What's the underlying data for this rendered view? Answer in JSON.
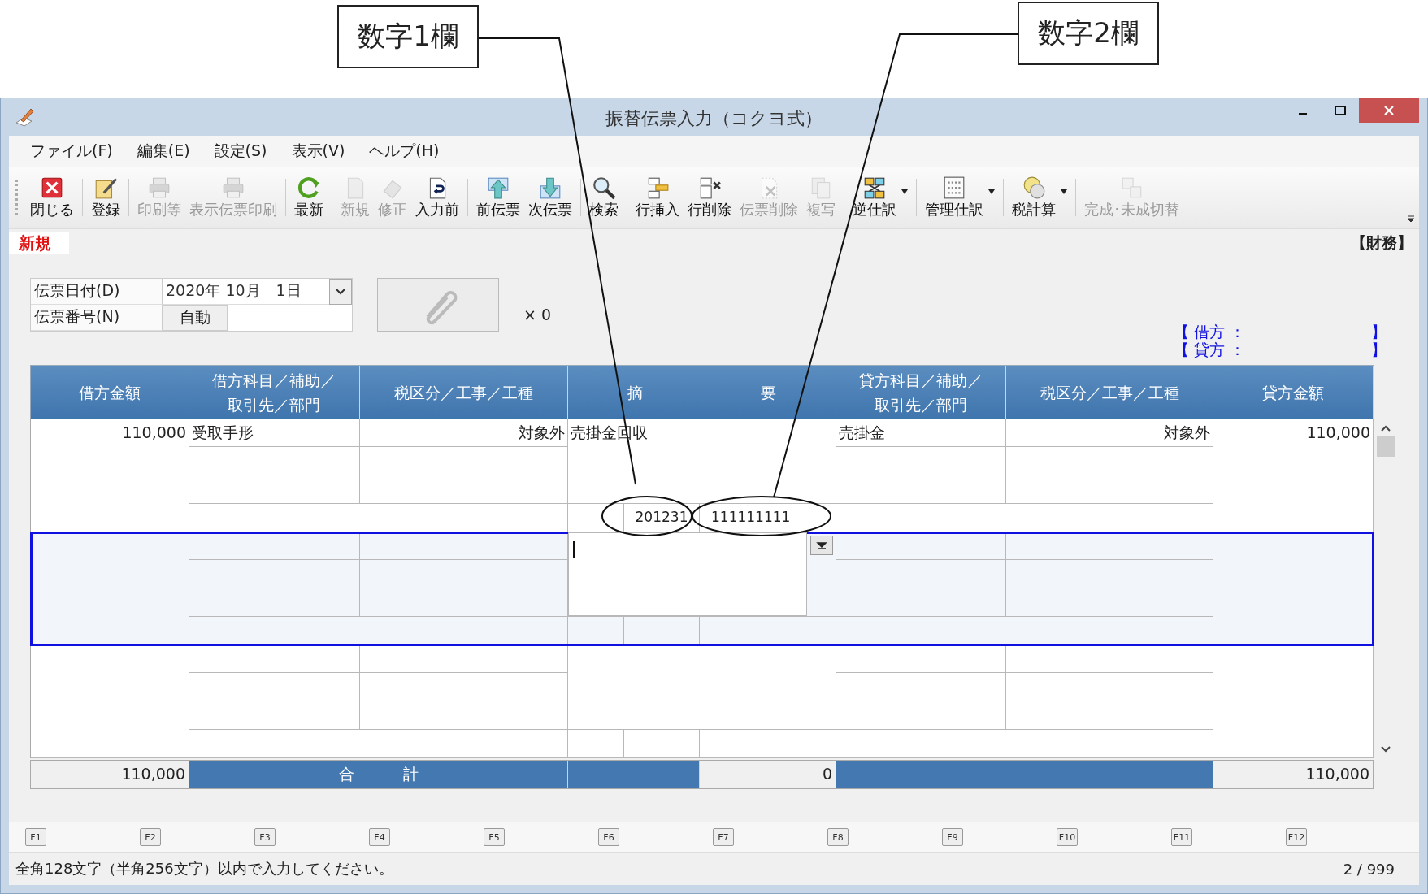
{
  "callouts": [
    {
      "label": "数字1欄"
    },
    {
      "label": "数字2欄"
    }
  ],
  "window": {
    "title": "振替伝票入力（コクヨ式）"
  },
  "menu": [
    {
      "label": "ファイル(F)"
    },
    {
      "label": "編集(E)"
    },
    {
      "label": "設定(S)"
    },
    {
      "label": "表示(V)"
    },
    {
      "label": "ヘルプ(H)"
    }
  ],
  "toolbar": [
    {
      "label": "閉じる",
      "disabled": false,
      "dropdown": false
    },
    {
      "label": "登録",
      "disabled": false,
      "dropdown": false
    },
    {
      "label": "印刷等",
      "disabled": true,
      "dropdown": false
    },
    {
      "label": "表示伝票印刷",
      "disabled": true,
      "dropdown": false
    },
    {
      "label": "最新",
      "disabled": false,
      "dropdown": false
    },
    {
      "label": "新規",
      "disabled": true,
      "dropdown": false
    },
    {
      "label": "修正",
      "disabled": true,
      "dropdown": false
    },
    {
      "label": "入力前",
      "disabled": false,
      "dropdown": false
    },
    {
      "label": "前伝票",
      "disabled": false,
      "dropdown": false
    },
    {
      "label": "次伝票",
      "disabled": false,
      "dropdown": false
    },
    {
      "label": "検索",
      "disabled": false,
      "dropdown": false
    },
    {
      "label": "行挿入",
      "disabled": false,
      "dropdown": false
    },
    {
      "label": "行削除",
      "disabled": false,
      "dropdown": false
    },
    {
      "label": "伝票削除",
      "disabled": true,
      "dropdown": false
    },
    {
      "label": "複写",
      "disabled": true,
      "dropdown": false
    },
    {
      "label": "逆仕訳",
      "disabled": false,
      "dropdown": true
    },
    {
      "label": "管理仕訳",
      "disabled": false,
      "dropdown": true
    },
    {
      "label": "税計算",
      "disabled": false,
      "dropdown": true
    },
    {
      "label": "完成･未成切替",
      "disabled": true,
      "dropdown": false
    }
  ],
  "mode": "新規",
  "division": "【財務】",
  "form": {
    "date_label": "伝票日付(D)",
    "date_value": "2020年 10月　1日",
    "number_label": "伝票番号(N)",
    "number_value": "自動",
    "attachment_count": "× 0"
  },
  "balance": [
    {
      "open": "【",
      "label": "借方 ：",
      "close": "】"
    },
    {
      "open": "【",
      "label": "貸方 ：",
      "close": "】"
    }
  ],
  "columns": [
    {
      "label": "借方金額"
    },
    {
      "label": "借方科目／補助／取引先／部門"
    },
    {
      "label": "税区分／工事／工種"
    },
    {
      "label": "摘",
      "label_2": "要"
    },
    {
      "label": "貸方科目／補助／取引先／部門"
    },
    {
      "label": "税区分／工事／工種"
    },
    {
      "label": "貸方金額"
    }
  ],
  "entries": [
    {
      "selected": false,
      "debit_amount": "110,000",
      "debit_account": "受取手形",
      "debit_tax": "対象外",
      "summary": "売掛金回収",
      "number_1": "201231",
      "number_2": "111111111",
      "credit_account": "売掛金",
      "credit_tax": "対象外",
      "credit_amount": "110,000"
    },
    {
      "selected": true
    },
    {
      "selected": false
    }
  ],
  "totals": {
    "debit": "110,000",
    "label": "合",
    "label_2": "計",
    "summary": "0",
    "credit": "110,000"
  },
  "function_keys": [
    "F1",
    "F2",
    "F3",
    "F4",
    "F5",
    "F6",
    "F7",
    "F8",
    "F9",
    "F10",
    "F11",
    "F12"
  ],
  "status": {
    "message": "全角128文字（半角256文字）以内で入力してください。",
    "page": "2 / 999"
  }
}
